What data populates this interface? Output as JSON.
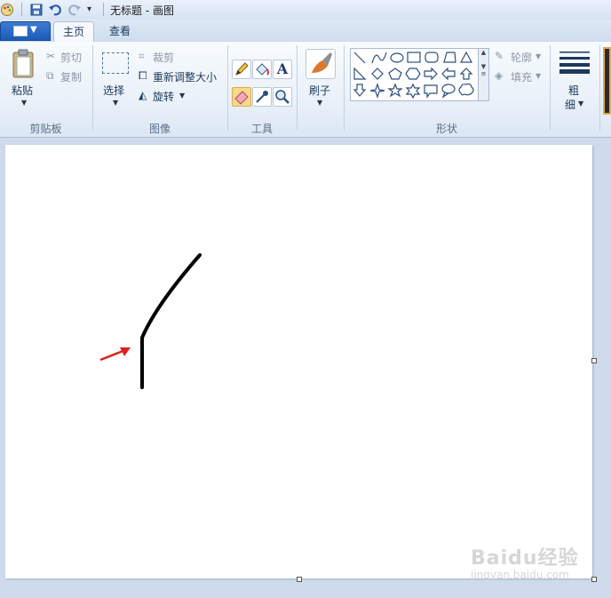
{
  "window": {
    "title": "无标题 - 画图"
  },
  "tabs": [
    {
      "label": "主页",
      "active": true
    },
    {
      "label": "查看",
      "active": false
    }
  ],
  "ribbon": {
    "clipboard": {
      "paste": "粘贴",
      "cut": "剪切",
      "copy": "复制",
      "label": "剪贴板"
    },
    "image": {
      "select": "选择",
      "crop": "裁剪",
      "resize": "重新调整大小",
      "rotate": "旋转",
      "label": "图像"
    },
    "tools": {
      "label": "工具",
      "active_tool": "eraser",
      "items": [
        "pencil-icon",
        "fill-icon",
        "text-icon",
        "eraser-icon",
        "color-picker-icon",
        "magnifier-icon"
      ]
    },
    "brushes": {
      "label": "刷子"
    },
    "shapes": {
      "label": "形状",
      "outline": "轮廓",
      "fill": "填充"
    },
    "size": {
      "label_top": "粗",
      "label_bottom": "细"
    }
  },
  "canvas": {
    "background": "#ffffff",
    "stroke_color": "#000000",
    "arrow_color": "#e02020"
  },
  "watermark": {
    "brand": "Baidu经验",
    "url": "jingyan.baidu.com"
  }
}
